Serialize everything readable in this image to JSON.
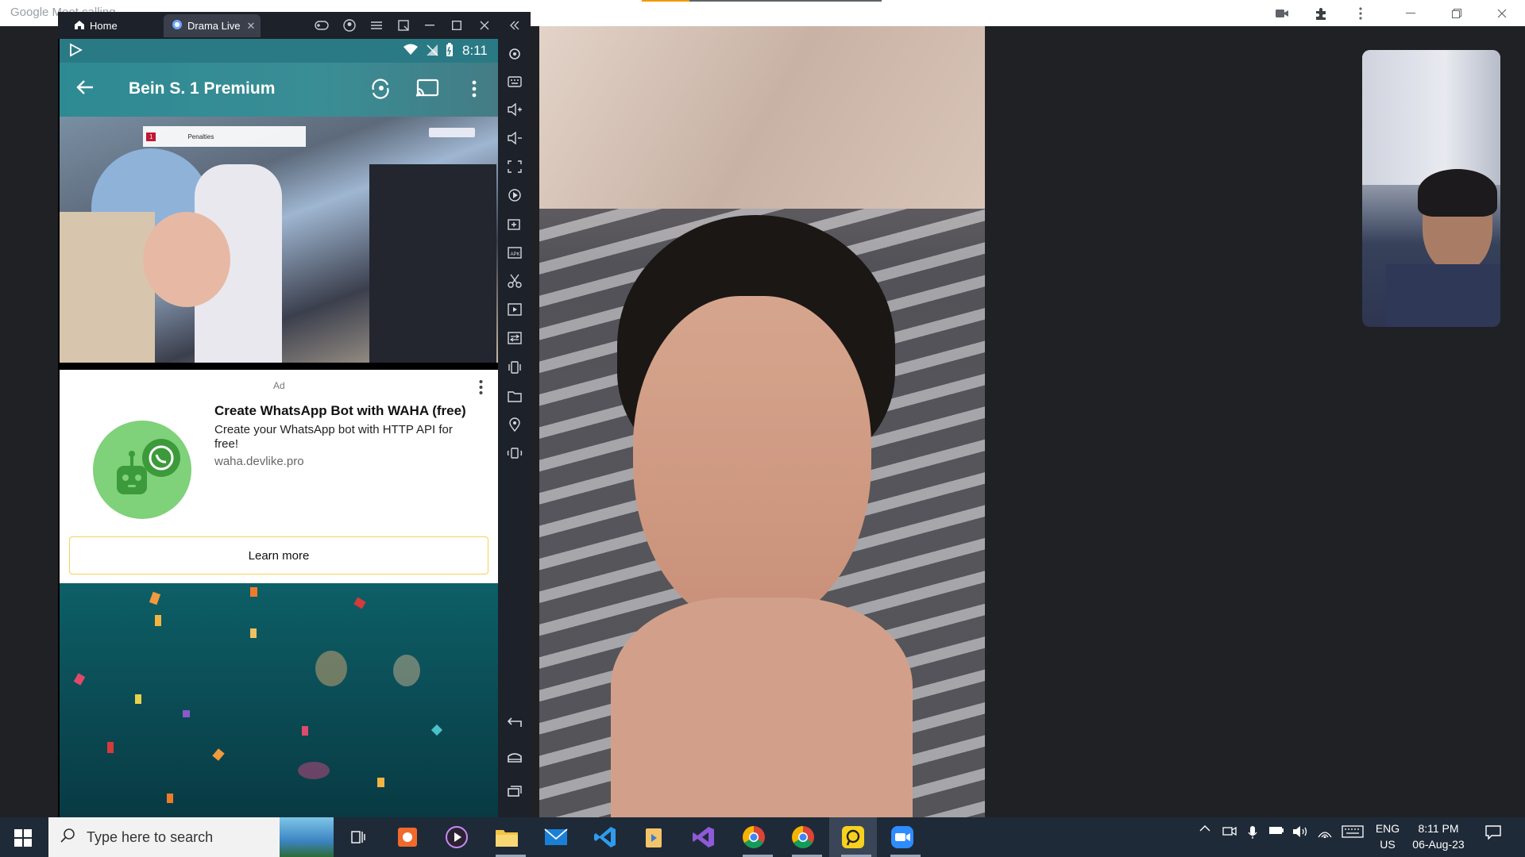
{
  "meet": {
    "title": "Google Meet calling"
  },
  "emulator": {
    "tabs": [
      {
        "label": "Home",
        "icon": "home-icon"
      },
      {
        "label": "Drama Live",
        "icon": "app-icon"
      }
    ]
  },
  "android": {
    "status": {
      "time": "8:11"
    },
    "appbar": {
      "title": "Bein S. 1 Premium"
    },
    "video": {
      "scoreboard_label": "Penalties",
      "overlay_score": "1"
    }
  },
  "ad": {
    "label": "Ad",
    "title": "Create WhatsApp Bot with WAHA (free)",
    "description": "Create your WhatsApp bot with HTTP API for free!",
    "url": "waha.devlike.pro",
    "cta": "Learn more"
  },
  "taskbar": {
    "search_placeholder": "Type here to search",
    "lang_top": "ENG",
    "lang_bottom": "US",
    "time": "8:11 PM",
    "date": "06-Aug-23"
  },
  "colors": {
    "accent_teal": "#2d8a93",
    "learn_more_border": "#f2d15c",
    "whatsapp_green": "#25d366"
  }
}
